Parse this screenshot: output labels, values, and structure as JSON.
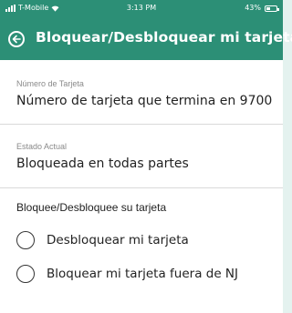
{
  "status_bar": {
    "carrier": "T-Mobile",
    "time": "3:13 PM",
    "battery": "43%",
    "battery_level": 0.43
  },
  "header": {
    "title": "Bloquear/Desbloquear mi tarjeta"
  },
  "card_number": {
    "label": "Número de Tarjeta",
    "value": "Número de tarjeta que termina en 9700"
  },
  "current_status": {
    "label": "Estado Actual",
    "value": "Bloqueada en todas partes"
  },
  "lock_section": {
    "title": "Bloquee/Desbloquee su tarjeta",
    "options": [
      {
        "label": "Desbloquear mi tarjeta",
        "selected": false
      },
      {
        "label": "Bloquear mi tarjeta fuera de NJ",
        "selected": false
      }
    ]
  },
  "colors": {
    "header": "#2c8f76",
    "background": "#e4f2ef"
  }
}
